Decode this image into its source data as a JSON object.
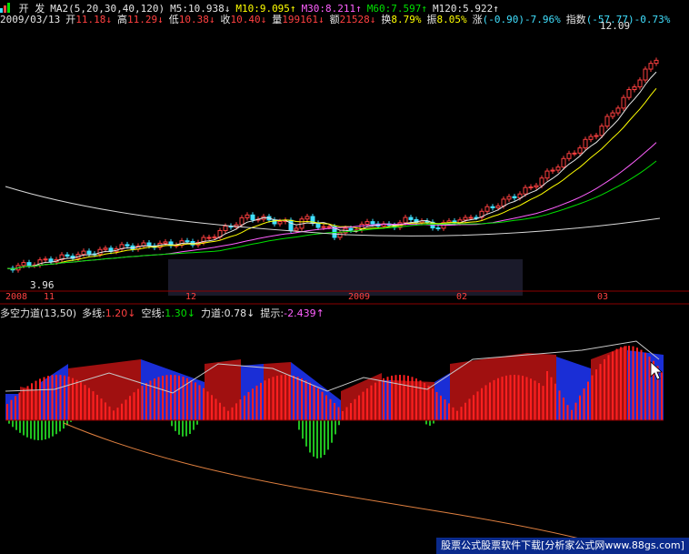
{
  "header": {
    "stock_name": "开 发",
    "ma_label": "MA2(5,20,30,40,120)",
    "ma": [
      {
        "label": "M5:10.938↓",
        "color": "#e6e6e6"
      },
      {
        "label": "M10:9.095↑",
        "color": "#ffff00"
      },
      {
        "label": "M30:8.211↑",
        "color": "#ff60ff"
      },
      {
        "label": "M60:7.597↑",
        "color": "#00e000"
      },
      {
        "label": "M120:5.922↑",
        "color": "#e6e6e6"
      }
    ]
  },
  "quote": {
    "date": "2009/03/13",
    "items": [
      {
        "label": "开",
        "value": "11.18↓",
        "color": "#ff4040"
      },
      {
        "label": "高",
        "value": "11.29↓",
        "color": "#ff4040"
      },
      {
        "label": "低",
        "value": "10.38↓",
        "color": "#ff4040"
      },
      {
        "label": "收",
        "value": "10.40↓",
        "color": "#ff4040"
      },
      {
        "label": "量",
        "value": "199161↓",
        "color": "#ff4040"
      },
      {
        "label": "额",
        "value": "21528↓",
        "color": "#ff4040"
      },
      {
        "label": "换",
        "value": "8.79%",
        "color": "#ffff00"
      },
      {
        "label": "振",
        "value": "8.05%",
        "color": "#ffff00"
      },
      {
        "label": "涨",
        "value": "(-0.90)-7.96%",
        "color": "#40e0ff"
      },
      {
        "label": "指数",
        "value": "(-57.77)-0.73%",
        "color": "#40e0ff"
      }
    ]
  },
  "price_labels": {
    "high": "12.09",
    "low": "3.96"
  },
  "date_axis": [
    "2008",
    "11",
    "12",
    "2009",
    "02",
    "03"
  ],
  "indicator": {
    "name": "多空力道(13,50)",
    "items": [
      {
        "label": "多线:",
        "value": "1.20↓",
        "color": "#ff4040"
      },
      {
        "label": "空线:",
        "value": "1.30↓",
        "color": "#00e000"
      },
      {
        "label": "力道:",
        "value": "0.78↓",
        "color": "#e6e6e6"
      },
      {
        "label": "提示:",
        "value": "-2.439↑",
        "color": "#ff60ff"
      }
    ]
  },
  "footer": {
    "text": "股票公式股票软件下载[分析家公式网www.88gs.com]"
  }
}
